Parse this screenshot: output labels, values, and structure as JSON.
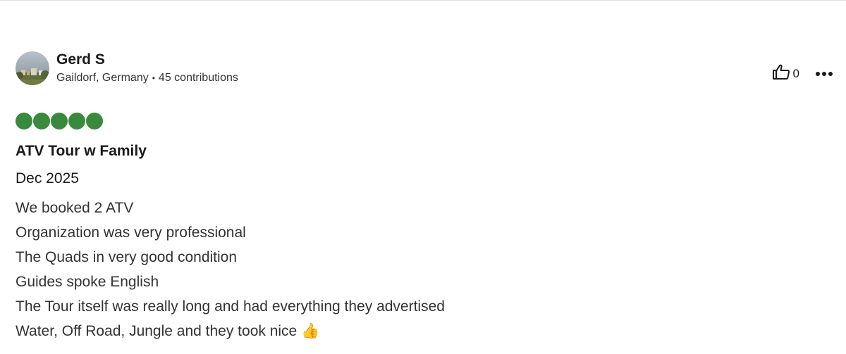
{
  "review": {
    "author": {
      "name": "Gerd S",
      "location": "Gaildorf, Germany",
      "separator": "•",
      "contributions": "45 contributions"
    },
    "actions": {
      "helpful_count": "0",
      "helpful_icon": "thumbs-up-outline-icon",
      "more_icon": "ellipsis-icon"
    },
    "rating": {
      "value": 5,
      "max": 5,
      "color": "#3a8a3e"
    },
    "title": "ATV Tour w Family",
    "date": "Dec 2025",
    "body_lines": [
      "We booked 2 ATV",
      "Organization was very professional",
      "The Quads in very good condition",
      "Guides spoke English",
      "The Tour itself was really long and had everything they advertised",
      "Water, Off Road, Jungle and they took nice 👍"
    ]
  }
}
